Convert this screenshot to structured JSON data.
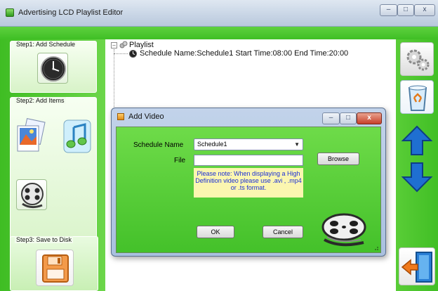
{
  "window": {
    "title": "Advertising LCD Playlist Editor",
    "controls": {
      "minimize": "–",
      "maximize": "□",
      "close": "x"
    }
  },
  "steps": {
    "step1_label": "Step1: Add Schedule",
    "step2_label": "Step2: Add Items",
    "step3_label": "Step3: Save to Disk"
  },
  "icons": {
    "schedule": "clock-icon",
    "image": "image-icon",
    "music": "music-icon",
    "video": "film-reel-icon",
    "save": "floppy-disk-icon",
    "settings": "gears-icon",
    "delete": "recycle-bin-icon",
    "move_up": "arrow-up-icon",
    "move_down": "arrow-down-icon",
    "exit": "exit-door-icon"
  },
  "tree": {
    "root": {
      "expander": "–",
      "label": "Playlist"
    },
    "schedule": "Schedule Name:Schedule1  Start Time:08:00  End Time:20:00"
  },
  "dialog": {
    "title": "Add Video",
    "controls": {
      "minimize": "–",
      "maximize": "□",
      "close": "x"
    },
    "schedule_name_label": "Schedule Name",
    "schedule_name_value": "Schedule1",
    "file_label": "File",
    "file_value": "",
    "browse_label": "Browse",
    "note": "Please note: When displaying a High Definition video please use .avi , .mp4 or .ts format.",
    "ok_label": "OK",
    "cancel_label": "Cancel"
  },
  "colors": {
    "green_panel": "#44c12a",
    "note_background": "#fbf6b0",
    "note_text": "#1a2fd6",
    "arrow_blue": "#1f6fd1"
  }
}
